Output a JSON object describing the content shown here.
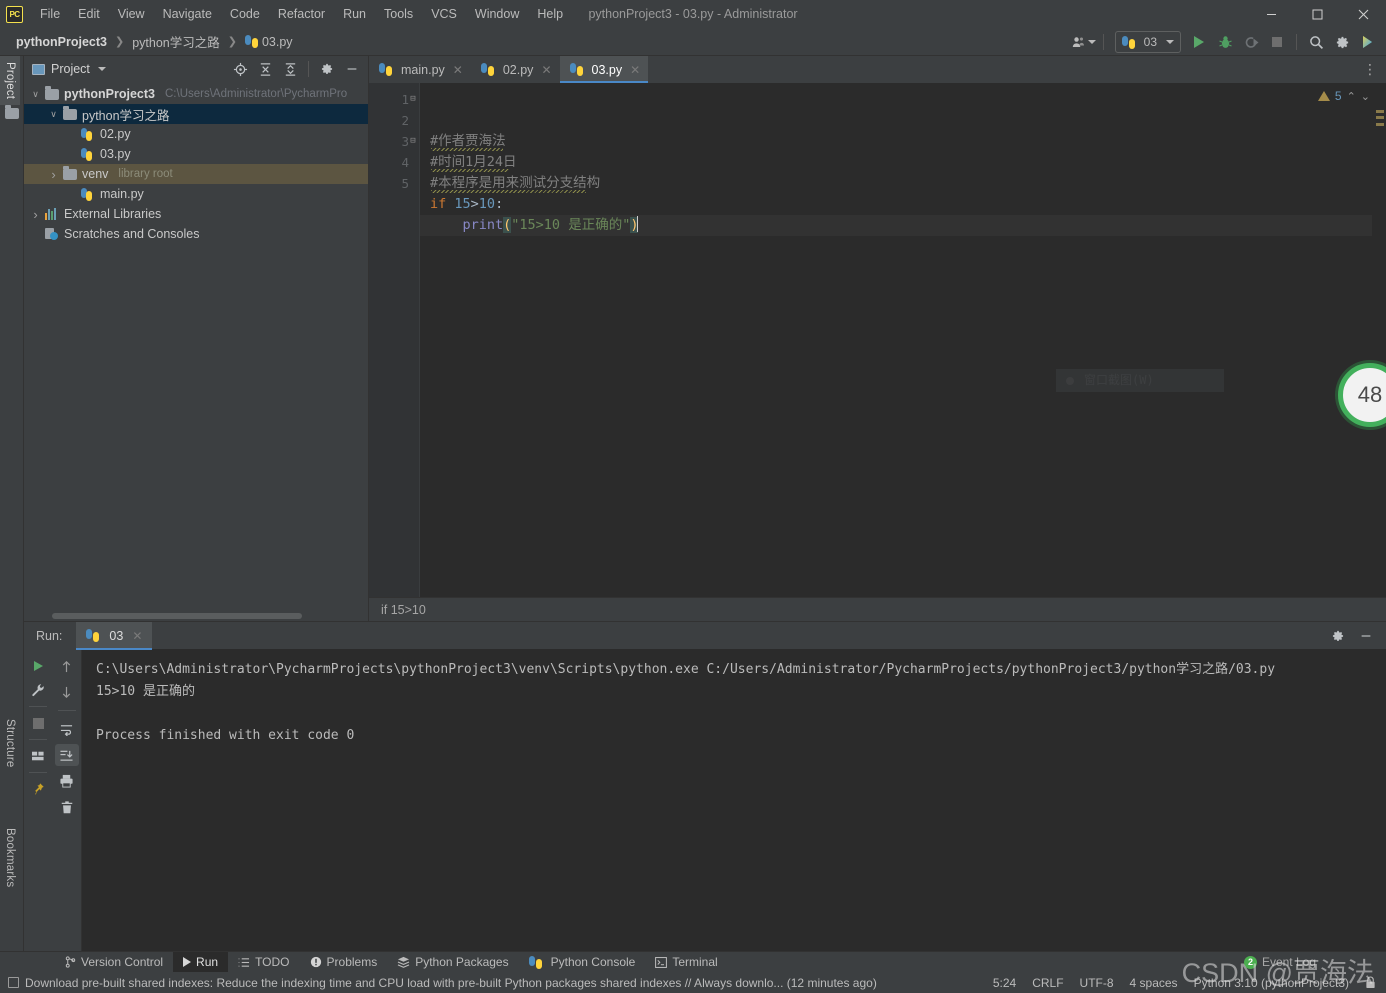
{
  "window": {
    "title": "pythonProject3 - 03.py - Administrator",
    "app_logo": "pycharm-logo",
    "minimize": "–",
    "maximize": "□",
    "close": "✕"
  },
  "menubar": {
    "items": [
      "File",
      "Edit",
      "View",
      "Navigate",
      "Code",
      "Refactor",
      "Run",
      "Tools",
      "VCS",
      "Window",
      "Help"
    ]
  },
  "navbar": {
    "crumbs": [
      "pythonProject3",
      "python学习之路",
      "03.py"
    ],
    "separator": "❯",
    "run_config": "03",
    "icons": [
      "user-avatar-icon",
      "run-icon",
      "debug-icon",
      "run-coverage-icon",
      "stop-icon",
      "search-everywhere-icon",
      "settings-icon",
      "ai-assistant-icon"
    ]
  },
  "left_strip": {
    "tabs": [
      "Project",
      "Structure",
      "Bookmarks"
    ],
    "active": "Project"
  },
  "project_panel": {
    "title": "Project",
    "toolbar_icons": [
      "locate-icon",
      "expand-all-icon",
      "collapse-all-icon",
      "settings-icon",
      "hide-icon"
    ],
    "tree": [
      {
        "label": "pythonProject3",
        "path": "C:\\Users\\Administrator\\PycharmPro",
        "indent": 0,
        "arrow": "▾",
        "icon": "folder-icon",
        "bold": true,
        "state": "none"
      },
      {
        "label": "python学习之路",
        "path": "",
        "indent": 1,
        "arrow": "▾",
        "icon": "folder-icon",
        "bold": false,
        "state": "selected"
      },
      {
        "label": "02.py",
        "path": "",
        "indent": 2,
        "arrow": "",
        "icon": "python-file-icon",
        "bold": false,
        "state": "none"
      },
      {
        "label": "03.py",
        "path": "",
        "indent": 2,
        "arrow": "",
        "icon": "python-file-icon",
        "bold": false,
        "state": "none"
      },
      {
        "label": "venv",
        "path": "library root",
        "indent": 1,
        "arrow": "›",
        "icon": "folder-icon",
        "bold": false,
        "state": "highlighted"
      },
      {
        "label": "main.py",
        "path": "",
        "indent": 2,
        "arrow": "",
        "icon": "python-file-icon",
        "bold": false,
        "state": "none"
      },
      {
        "label": "External Libraries",
        "path": "",
        "indent": 0,
        "arrow": "›",
        "icon": "library-icon",
        "bold": false,
        "state": "none"
      },
      {
        "label": "Scratches and Consoles",
        "path": "",
        "indent": 0,
        "arrow": "",
        "icon": "scratches-icon",
        "bold": false,
        "state": "none"
      }
    ]
  },
  "editor": {
    "tabs": [
      {
        "label": "main.py",
        "active": false
      },
      {
        "label": "02.py",
        "active": false
      },
      {
        "label": "03.py",
        "active": true
      }
    ],
    "close_glyph": "✕",
    "options_glyph": "⋮",
    "line_numbers": [
      "1",
      "2",
      "3",
      "4",
      "5"
    ],
    "fold_marks": [
      "⊟",
      "",
      "⊟",
      "",
      ""
    ],
    "lines": [
      {
        "n": 1,
        "parts": [
          {
            "t": "#作者贾海法",
            "c": "cm"
          }
        ]
      },
      {
        "n": 2,
        "parts": [
          {
            "t": "#时间1月24日",
            "c": "cm"
          }
        ]
      },
      {
        "n": 3,
        "parts": [
          {
            "t": "#本程序是用来测试分支结构",
            "c": "cm"
          }
        ]
      },
      {
        "n": 4,
        "parts": [
          {
            "t": "if ",
            "c": "kw"
          },
          {
            "t": "15",
            "c": "num"
          },
          {
            "t": ">",
            "c": "pl"
          },
          {
            "t": "10",
            "c": "num"
          },
          {
            "t": ":",
            "c": "pl"
          }
        ]
      },
      {
        "n": 5,
        "parts": [
          {
            "t": "    ",
            "c": "pl"
          },
          {
            "t": "print",
            "c": "fn"
          },
          {
            "t": "(",
            "c": "paren-hl"
          },
          {
            "t": "\"15>10 是正确的\"",
            "c": "str"
          },
          {
            "t": ")",
            "c": "paren-hl"
          }
        ]
      }
    ],
    "ghost_menu_item": "窗口截图(W)",
    "inspection_count": "5",
    "inspection_icon": "warning-triangle-icon",
    "chevron_up": "⌃",
    "chevron_down": "⌄",
    "circle_badge": "48",
    "breadcrumb_bottom": "if 15>10"
  },
  "run_panel": {
    "label": "Run:",
    "tab": "03",
    "close_glyph": "✕",
    "header_icons": [
      "settings-icon",
      "hide-icon"
    ],
    "side_icons_left": [
      "rerun-icon",
      "wrench-icon",
      "stop-icon",
      "layout-icon",
      "pin-icon"
    ],
    "side_icons_right": [
      "up-arrow-icon",
      "down-arrow-icon",
      "soft-wrap-icon",
      "scroll-to-end-icon",
      "print-icon",
      "trash-icon"
    ],
    "console_lines": [
      "C:\\Users\\Administrator\\PycharmProjects\\pythonProject3\\venv\\Scripts\\python.exe C:/Users/Administrator/PycharmProjects/pythonProject3/python学习之路/03.py",
      "15>10 是正确的",
      "",
      "Process finished with exit code 0"
    ]
  },
  "bottom_bar": {
    "items": [
      {
        "label": "Version Control",
        "icon": "branch-icon",
        "active": false
      },
      {
        "label": "Run",
        "icon": "run-icon",
        "active": true
      },
      {
        "label": "TODO",
        "icon": "todo-icon",
        "active": false
      },
      {
        "label": "Problems",
        "icon": "problems-icon",
        "active": false
      },
      {
        "label": "Python Packages",
        "icon": "packages-icon",
        "active": false
      },
      {
        "label": "Python Console",
        "icon": "python-icon",
        "active": false
      },
      {
        "label": "Terminal",
        "icon": "terminal-icon",
        "active": false
      }
    ]
  },
  "status_bar": {
    "message": "Download pre-built shared indexes: Reduce the indexing time and CPU load with pre-built Python packages shared indexes // Always downlo... (12 minutes ago)",
    "message_icon": "checkbox-icon",
    "caret_position": "5:24",
    "line_separator": "CRLF",
    "encoding": "UTF-8",
    "indent": "4 spaces",
    "interpreter": "Python 3.10 (pythonProject3)",
    "event_log": "Event Log",
    "event_count": "2",
    "lock_icon": "lock-icon"
  },
  "watermark": "CSDN @贾海法",
  "colors": {
    "bg": "#3c3f41",
    "editor_bg": "#2b2b2b",
    "accent": "#4a88c7",
    "selection": "#0d293e",
    "highlight": "#5c5541",
    "run_green": "#59a869",
    "badge_green": "#43b05c",
    "comment": "#808080",
    "keyword": "#cc7832",
    "number": "#6897bb",
    "string": "#6a8759",
    "function": "#8888c6"
  }
}
